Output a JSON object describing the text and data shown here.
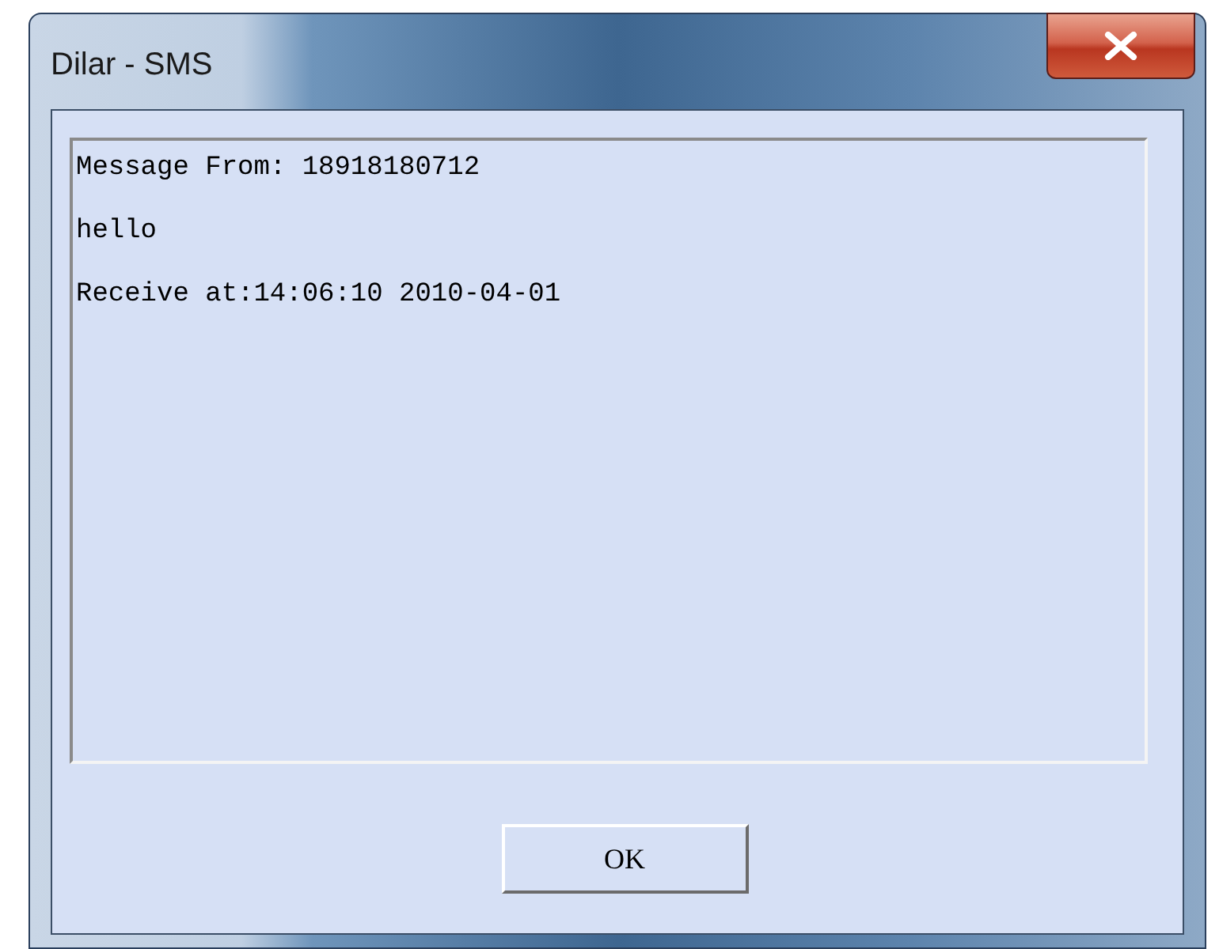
{
  "window": {
    "title": "Dilar - SMS"
  },
  "message": {
    "lines": [
      "Message From: 18918180712",
      "hello",
      "Receive at:14:06:10 2010-04-01"
    ]
  },
  "buttons": [
    "OK"
  ]
}
